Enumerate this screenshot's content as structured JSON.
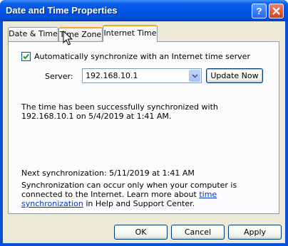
{
  "window": {
    "title": "Date and Time Properties"
  },
  "titlebar_buttons": {
    "help_icon": "question-icon",
    "close_icon": "close-icon"
  },
  "tabs": [
    {
      "label": "Date & Time"
    },
    {
      "label": "Time Zone"
    },
    {
      "label": "Internet Time"
    }
  ],
  "active_tab": "Internet Time",
  "sync": {
    "checkbox_label": "Automatically synchronize with an Internet time server",
    "checked": true
  },
  "server": {
    "label": "Server:",
    "value": "192.168.10.1",
    "update_button": "Update Now"
  },
  "status_message": "The time has been successfully synchronized with 192.168.10.1 on 5/4/2019 at 1:41 AM.",
  "next_sync": "Next synchronization: 5/11/2019 at 1:41 AM",
  "note": {
    "text_before": "Synchronization can occur only when your computer is connected to the Internet.  Learn more about ",
    "link_text": "time synchronization",
    "text_after": " in Help and Support Center."
  },
  "footer": {
    "ok": "OK",
    "cancel": "Cancel",
    "apply": "Apply"
  },
  "colors": {
    "titlebar": "#0054e3",
    "tab_highlight": "#f5a623",
    "link": "#0033cc",
    "client": "#ece9d8"
  }
}
